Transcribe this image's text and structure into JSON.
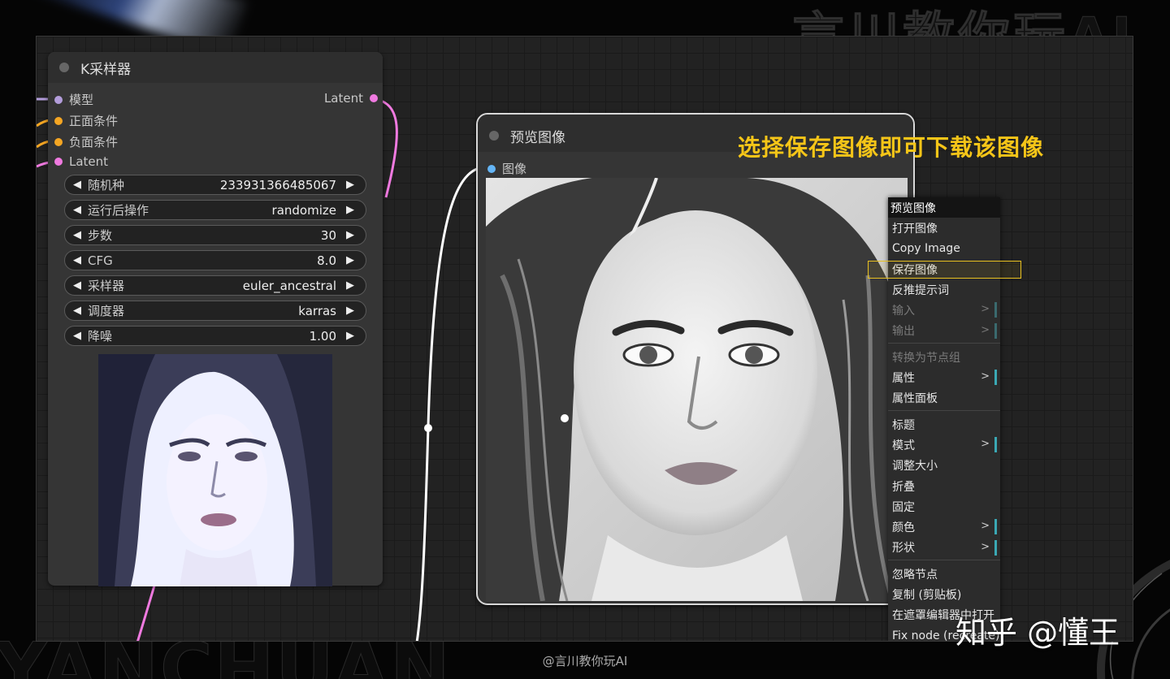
{
  "background": {
    "watermark_text": "言川教你玩AI",
    "corner_text": "YANCHUAN"
  },
  "ksampler": {
    "title": "K采样器",
    "inputs": [
      {
        "label": "模型",
        "color": "#b39ddb"
      },
      {
        "label": "正面条件",
        "color": "#f5a623"
      },
      {
        "label": "负面条件",
        "color": "#f5a623"
      },
      {
        "label": "Latent",
        "color": "#f07ae0"
      }
    ],
    "output": {
      "label": "Latent",
      "color": "#f07ae0"
    },
    "widgets": [
      {
        "label": "随机种",
        "value": "233931366485067"
      },
      {
        "label": "运行后操作",
        "value": "randomize"
      },
      {
        "label": "步数",
        "value": "30"
      },
      {
        "label": "CFG",
        "value": "8.0"
      },
      {
        "label": "采样器",
        "value": "euler_ancestral"
      },
      {
        "label": "调度器",
        "value": "karras"
      },
      {
        "label": "降噪",
        "value": "1.00"
      }
    ]
  },
  "preview_node": {
    "title": "预览图像",
    "input": {
      "label": "图像",
      "color": "#64b5f6"
    }
  },
  "context_menu": {
    "items": [
      {
        "label": "预览图像",
        "kind": "header"
      },
      {
        "label": "打开图像"
      },
      {
        "label": "Copy Image"
      },
      {
        "label": "保存图像",
        "highlighted": true
      },
      {
        "label": "反推提示词"
      },
      {
        "label": "输入",
        "disabled": true,
        "submenu": ">"
      },
      {
        "label": "输出",
        "disabled": true,
        "submenu": ">"
      },
      {
        "kind": "separator"
      },
      {
        "label": "转换为节点组",
        "disabled": true
      },
      {
        "label": "属性",
        "submenu": ">"
      },
      {
        "label": "属性面板"
      },
      {
        "kind": "separator"
      },
      {
        "label": "标题"
      },
      {
        "label": "模式",
        "submenu": ">"
      },
      {
        "label": "调整大小"
      },
      {
        "label": "折叠"
      },
      {
        "label": "固定"
      },
      {
        "label": "颜色",
        "submenu": ">"
      },
      {
        "label": "形状",
        "submenu": ">"
      },
      {
        "kind": "separator"
      },
      {
        "label": "忽略节点"
      },
      {
        "label": "复制 (剪贴板)"
      },
      {
        "label": "在遮罩编辑器中打开"
      },
      {
        "label": "Fix node (recreate)"
      }
    ]
  },
  "annotation": "选择保存图像即可下载该图像",
  "zhihu_watermark": "知乎 @懂王",
  "credit": "@言川教你玩AI",
  "colors": {
    "annotation": "#f5c518",
    "highlight": "#e8c020",
    "link_white": "#ffffff",
    "link_pink": "#f07ae0",
    "link_orange": "#f5a623",
    "link_purple": "#b39ddb"
  }
}
